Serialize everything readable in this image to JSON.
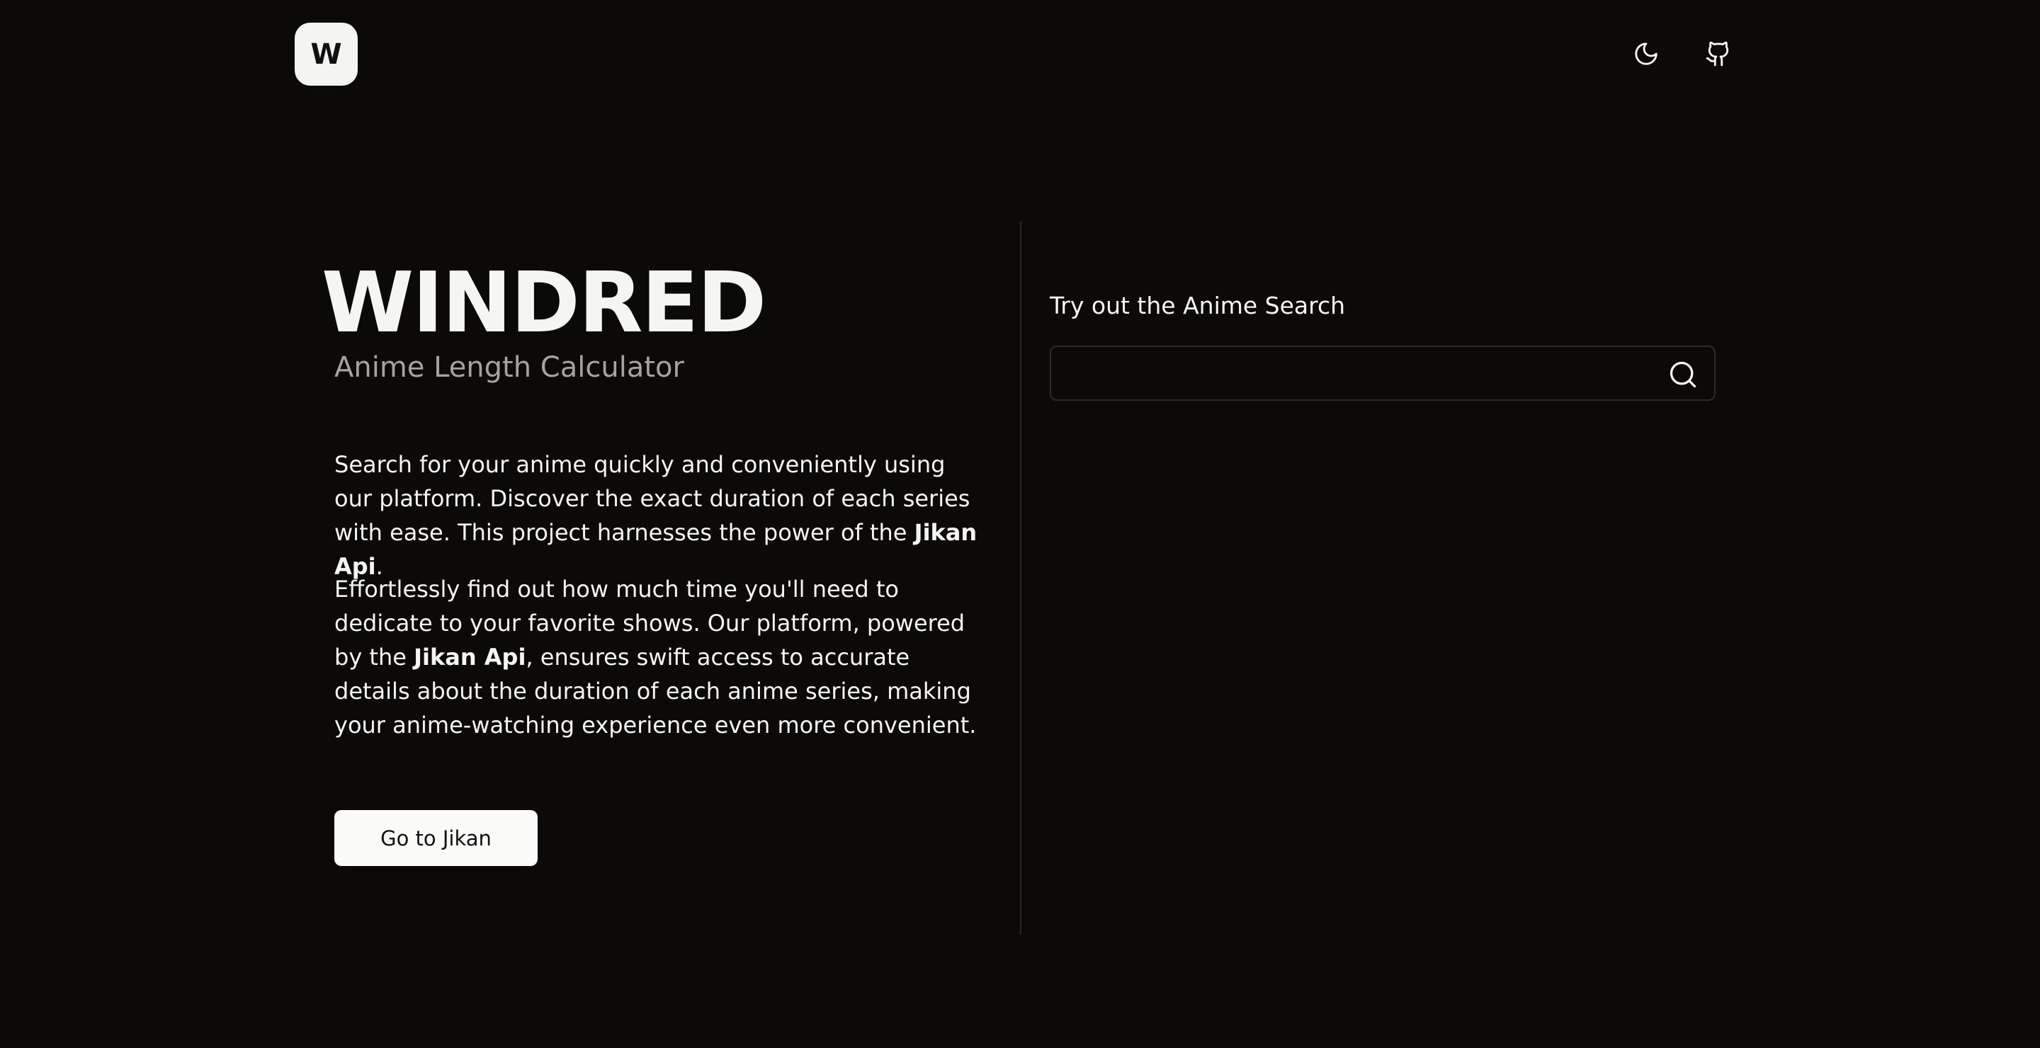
{
  "header": {
    "logo_letter": "W",
    "theme_toggle_icon": "moon-icon",
    "github_icon": "github-icon"
  },
  "hero": {
    "title": "WINDRED",
    "subtitle": "Anime Length Calculator"
  },
  "description": {
    "p1_a": "Search for your anime quickly and conveniently using our platform. Discover the exact duration of each series with ease. This project harnesses the power of the ",
    "p1_bold": "Jikan Api",
    "p1_b": ".",
    "p2_a": "Effortlessly find out how much time you'll need to dedicate to your favorite shows. Our platform, powered by the ",
    "p2_bold": "Jikan Api",
    "p2_b": ", ensures swift access to accurate details about the duration of each anime series, making your anime-watching experience even more convenient."
  },
  "cta": {
    "label": "Go to Jikan"
  },
  "search": {
    "label": "Try out the Anime Search",
    "value": "",
    "icon": "search-icon"
  },
  "colors": {
    "background": "#0b0a09",
    "text": "#f5f5f4",
    "muted_text": "#a8a29e",
    "button_bg": "#fafaf9",
    "border": "#2b2a29"
  }
}
